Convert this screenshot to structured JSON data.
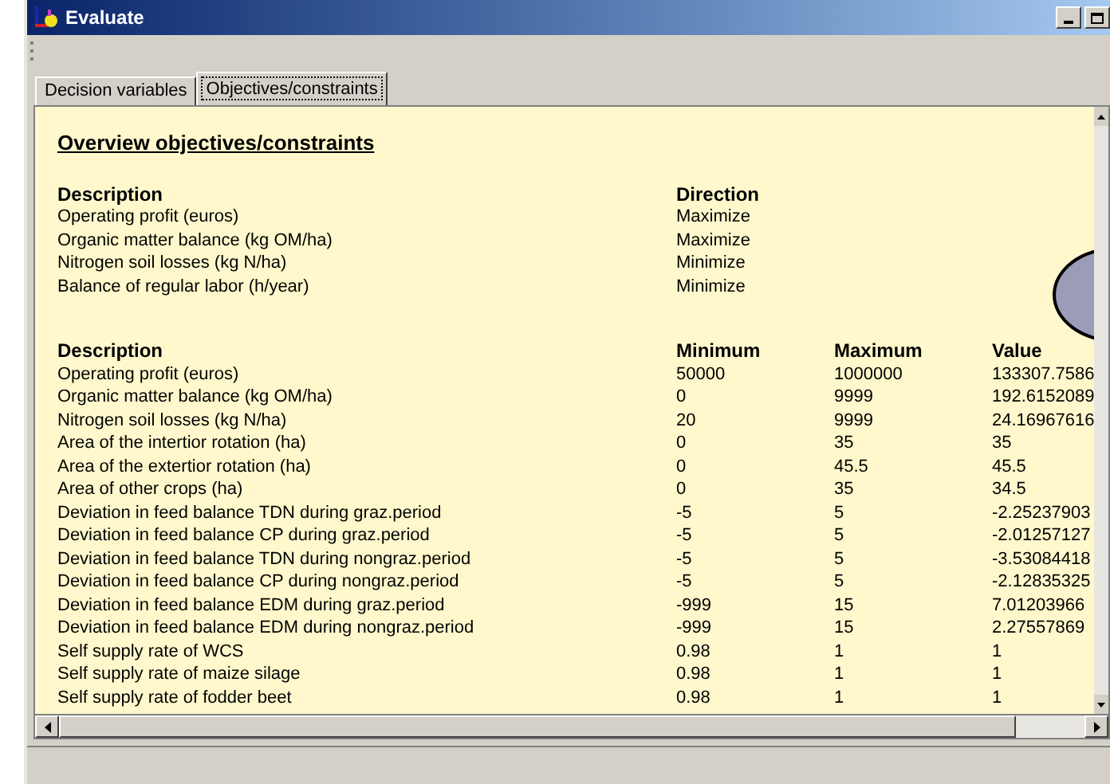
{
  "window": {
    "title": "Evaluate"
  },
  "tabs": [
    {
      "label": "Decision variables",
      "selected": false
    },
    {
      "label": "Objectives/constraints",
      "selected": true
    }
  ],
  "report": {
    "title": "Overview objectives/constraints",
    "objectives": {
      "columns": [
        "Description",
        "Direction"
      ],
      "rows": [
        [
          "Operating profit (euros)",
          "Maximize"
        ],
        [
          "Organic matter balance (kg OM/ha)",
          "Maximize"
        ],
        [
          "Nitrogen soil losses (kg N/ha)",
          "Minimize"
        ],
        [
          "Balance of regular labor (h/year)",
          "Minimize"
        ]
      ]
    },
    "constraints": {
      "columns": [
        "Description",
        "Minimum",
        "Maximum",
        "Value"
      ],
      "rows": [
        [
          "Operating profit (euros)",
          "50000",
          "1000000",
          "133307.7586"
        ],
        [
          "Organic matter balance (kg OM/ha)",
          "0",
          "9999",
          "192.6152089"
        ],
        [
          "Nitrogen soil losses (kg N/ha)",
          "20",
          "9999",
          "24.16967616"
        ],
        [
          "Area of the intertior rotation (ha)",
          "0",
          "35",
          "35"
        ],
        [
          "Area of the extertior rotation (ha)",
          "0",
          "45.5",
          "45.5"
        ],
        [
          "Area of other crops (ha)",
          "0",
          "35",
          "34.5"
        ],
        [
          "Deviation in feed balance TDN during graz.period",
          "-5",
          "5",
          "-2.25237903"
        ],
        [
          "Deviation in feed balance CP during graz.period",
          "-5",
          "5",
          "-2.01257127"
        ],
        [
          "Deviation in feed balance TDN during nongraz.period",
          "-5",
          "5",
          "-3.53084418"
        ],
        [
          "Deviation in feed balance CP during nongraz.period",
          "-5",
          "5",
          "-2.12835325"
        ],
        [
          "Deviation in feed balance EDM during graz.period",
          "-999",
          "15",
          "7.01203966"
        ],
        [
          "Deviation in feed balance EDM during nongraz.period",
          "-999",
          "15",
          "2.27557869"
        ],
        [
          "Self supply rate of WCS",
          "0.98",
          "1",
          "1"
        ],
        [
          "Self supply rate of maize silage",
          "0.98",
          "1",
          "1"
        ],
        [
          "Self supply rate of fodder beet",
          "0.98",
          "1",
          "1"
        ]
      ]
    }
  }
}
